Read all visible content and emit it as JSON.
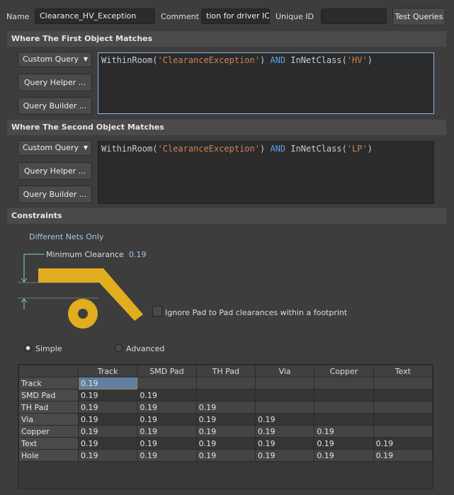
{
  "header": {
    "name_label": "Name",
    "name_value": "Clearance_HV_Exception",
    "comment_label": "Comment",
    "comment_value": "tion for driver IC",
    "uid_label": "Unique ID",
    "uid_value": "",
    "test_button": "Test Queries"
  },
  "first": {
    "title": "Where The First Object Matches",
    "query_type": "Custom Query",
    "helper": "Query Helper ...",
    "builder": "Query Builder ...",
    "q1": "WithinRoom(",
    "q2": "'ClearanceException'",
    "q3": ") ",
    "q4": "AND",
    "q5": " InNetClass(",
    "q6": "'HV'",
    "q7": ")"
  },
  "second": {
    "title": "Where The Second Object Matches",
    "query_type": "Custom Query",
    "helper": "Query Helper ...",
    "builder": "Query Builder ...",
    "q1": "WithinRoom(",
    "q2": "'ClearanceException'",
    "q3": ") ",
    "q4": "AND",
    "q5": " InNetClass(",
    "q6": "'LP'",
    "q7": ")"
  },
  "constraints": {
    "title": "Constraints",
    "nets": "Different Nets Only",
    "min_label": "Minimum Clearance",
    "min_value": "0.19",
    "ignore_label": "Ignore Pad to Pad clearances within a footprint",
    "ignore_checked": false,
    "simple": "Simple",
    "advanced": "Advanced",
    "mode": "Simple",
    "copper_color": "#e0ae1e"
  },
  "table": {
    "columns": [
      "Track",
      "SMD Pad",
      "TH Pad",
      "Via",
      "Copper",
      "Text"
    ],
    "rows": [
      {
        "label": "Track",
        "values": [
          "0.19",
          "",
          "",
          "",
          "",
          ""
        ]
      },
      {
        "label": "SMD Pad",
        "values": [
          "0.19",
          "0.19",
          "",
          "",
          "",
          ""
        ]
      },
      {
        "label": "TH Pad",
        "values": [
          "0.19",
          "0.19",
          "0.19",
          "",
          "",
          ""
        ]
      },
      {
        "label": "Via",
        "values": [
          "0.19",
          "0.19",
          "0.19",
          "0.19",
          "",
          ""
        ]
      },
      {
        "label": "Copper",
        "values": [
          "0.19",
          "0.19",
          "0.19",
          "0.19",
          "0.19",
          ""
        ]
      },
      {
        "label": "Text",
        "values": [
          "0.19",
          "0.19",
          "0.19",
          "0.19",
          "0.19",
          "0.19"
        ]
      },
      {
        "label": "Hole",
        "values": [
          "0.19",
          "0.19",
          "0.19",
          "0.19",
          "0.19",
          "0.19"
        ]
      }
    ]
  }
}
